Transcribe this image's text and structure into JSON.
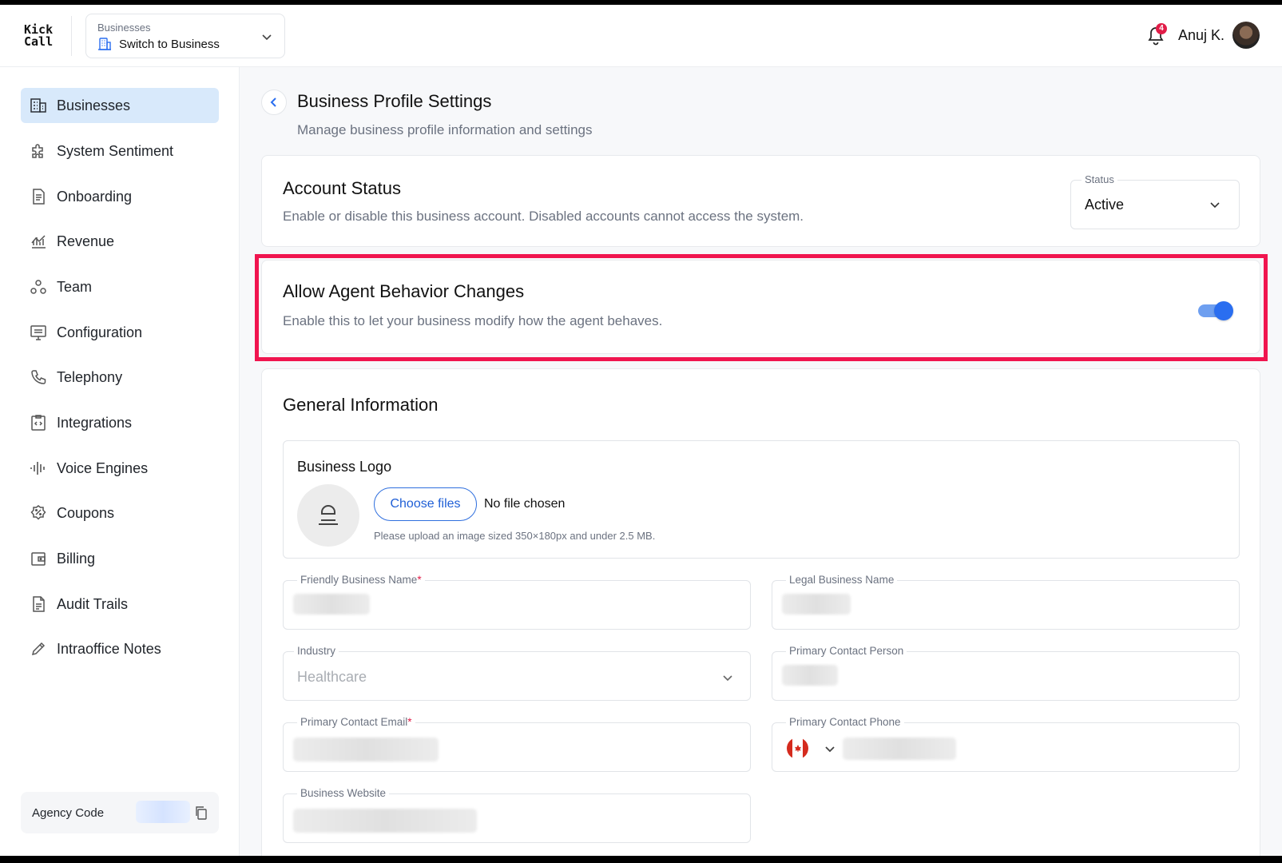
{
  "header": {
    "logo_line1": "Kick",
    "logo_line2": "Call",
    "business_switcher": {
      "label": "Businesses",
      "value": "Switch to Business"
    },
    "notification_count": "4",
    "user_name": "Anuj K."
  },
  "sidebar": {
    "items": [
      {
        "label": "Businesses",
        "icon": "building-icon",
        "active": true
      },
      {
        "label": "System Sentiment",
        "icon": "puzzle-icon"
      },
      {
        "label": "Onboarding",
        "icon": "document-icon"
      },
      {
        "label": "Revenue",
        "icon": "chart-icon"
      },
      {
        "label": "Team",
        "icon": "team-icon"
      },
      {
        "label": "Configuration",
        "icon": "monitor-settings-icon"
      },
      {
        "label": "Telephony",
        "icon": "phone-icon"
      },
      {
        "label": "Integrations",
        "icon": "code-clipboard-icon"
      },
      {
        "label": "Voice Engines",
        "icon": "waveform-icon"
      },
      {
        "label": "Coupons",
        "icon": "coupon-icon"
      },
      {
        "label": "Billing",
        "icon": "wallet-icon"
      },
      {
        "label": "Audit Trails",
        "icon": "file-lines-icon"
      },
      {
        "label": "Intraoffice Notes",
        "icon": "pencil-icon"
      }
    ],
    "agency_code_label": "Agency Code"
  },
  "page": {
    "title": "Business Profile Settings",
    "subtitle": "Manage business profile information and settings"
  },
  "account_status": {
    "title": "Account Status",
    "description": "Enable or disable this business account. Disabled accounts cannot access the system.",
    "status_label": "Status",
    "status_value": "Active"
  },
  "agent_behavior": {
    "title": "Allow Agent Behavior Changes",
    "description": "Enable this to let your business modify how the agent behaves.",
    "enabled": true,
    "highlight_color": "#f0154f"
  },
  "general": {
    "title": "General Information",
    "logo": {
      "title": "Business Logo",
      "button": "Choose files",
      "no_file": "No file chosen",
      "hint": "Please upload an image sized 350×180px and under 2.5 MB."
    },
    "fields": {
      "friendly_name": "Friendly Business Name",
      "legal_name": "Legal Business Name",
      "industry": "Industry",
      "industry_value": "Healthcare",
      "contact_person": "Primary Contact Person",
      "contact_email": "Primary Contact Email",
      "contact_phone": "Primary Contact Phone",
      "website": "Business Website",
      "required_mark": "*"
    }
  },
  "colors": {
    "accent": "#2a6ef0",
    "active_nav": "#d8e9fb",
    "badge": "#e11d48"
  }
}
